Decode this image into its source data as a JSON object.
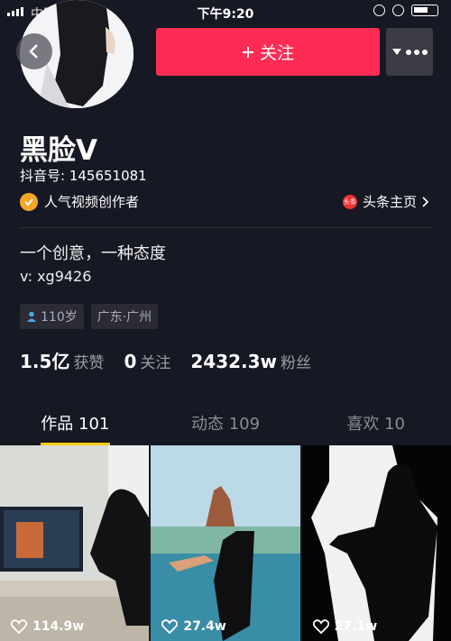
{
  "status_bar": {
    "carrier": "中国移动",
    "time": "下午9:20"
  },
  "profile": {
    "name": "黑脸V",
    "douyin_id": "抖音号: 145651081",
    "creator_label": "人气视频创作者",
    "toutiao_label": "头条主页",
    "toutiao_logo_text": "头条",
    "bio_line1": "一个创意，一种态度",
    "bio_line2": "v:   xg9426",
    "tags": [
      "110岁",
      "广东·广州"
    ]
  },
  "actions": {
    "follow_label": "关注"
  },
  "stats": [
    {
      "num": "1.5亿",
      "label": "获赞"
    },
    {
      "num": "0",
      "label": "关注"
    },
    {
      "num": "2432.3w",
      "label": "粉丝"
    }
  ],
  "tabs": [
    {
      "label": "作品 101"
    },
    {
      "label": "动态 109"
    },
    {
      "label": "喜欢 10"
    }
  ],
  "videos": [
    {
      "likes": "114.9w"
    },
    {
      "likes": "27.4w"
    },
    {
      "likes": "27.1w"
    }
  ],
  "colors": {
    "accent": "#FE2C55",
    "tab_indicator": "#FACE15",
    "background": "#161823"
  }
}
